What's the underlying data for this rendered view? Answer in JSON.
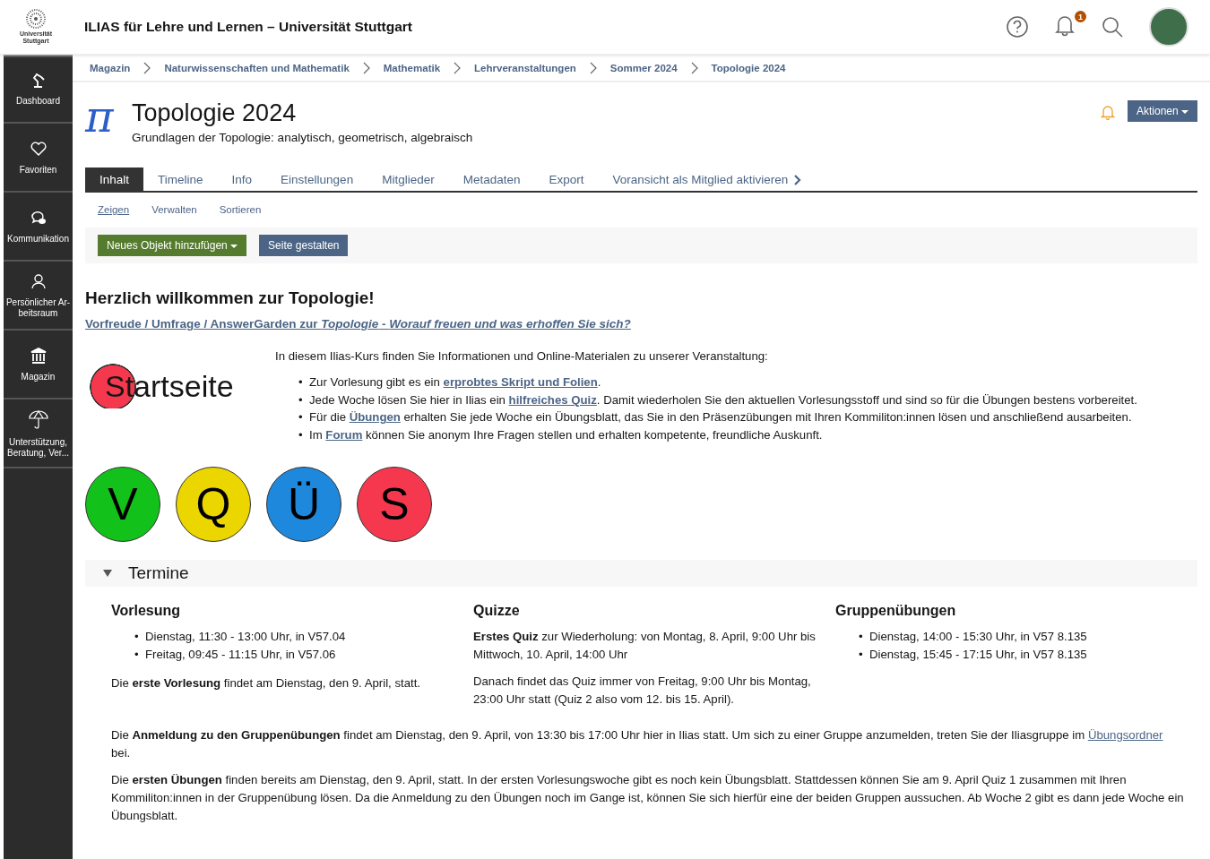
{
  "header": {
    "logo_text": "Universität Stuttgart",
    "title": "ILIAS für Lehre und Lernen – Universität Stuttgart",
    "notification_count": "1"
  },
  "sidebar": {
    "items": [
      {
        "kind": "dashboard",
        "label": "Dashboard",
        "selected": false
      },
      {
        "kind": "favorites",
        "label": "Favoriten",
        "selected": false
      },
      {
        "kind": "communication",
        "label": "Kommunikation",
        "selected": false
      },
      {
        "kind": "personal",
        "label": "Persönlicher Ar-beitsraum",
        "selected": false
      },
      {
        "kind": "repository",
        "label": "Magazin",
        "selected": false
      },
      {
        "kind": "support",
        "label": "Unterstützung, Beratung, Ver...",
        "selected": false
      }
    ]
  },
  "breadcrumbs": [
    "Magazin",
    "Naturwissenschaften und Mathematik",
    "Mathematik",
    "Lehrveranstaltungen",
    "Sommer 2024",
    "Topologie 2024"
  ],
  "course": {
    "icon_text": "π",
    "title": "Topologie 2024",
    "subtitle": "Grundlagen der Topologie: analytisch, geometrisch, algebraisch",
    "actions": "Aktionen"
  },
  "tabs": [
    {
      "label": "Inhalt",
      "selected": true
    },
    {
      "label": "Timeline",
      "selected": false
    },
    {
      "label": "Info",
      "selected": false
    },
    {
      "label": "Einstellungen",
      "selected": false
    },
    {
      "label": "Mitglieder",
      "selected": false
    },
    {
      "label": "Metadaten",
      "selected": false
    },
    {
      "label": "Export",
      "selected": false
    },
    {
      "label": "Voransicht als Mitglied aktivieren",
      "selected": false
    }
  ],
  "subtabs": [
    {
      "label": "Zeigen",
      "selected": true
    },
    {
      "label": "Verwalten",
      "selected": false
    },
    {
      "label": "Sortieren",
      "selected": false
    }
  ],
  "toolbar": {
    "add_button": "Neues Objekt hinzufügen",
    "layout_button": "Seite gestalten"
  },
  "welcome": {
    "heading": "Herzlich willkommen zur Topologie!",
    "link": "Vorfreude / Umfrage / AnswerGarden zur *Topologie* - *Worauf freuen und was erhoffen Sie sich?*"
  },
  "start_badge": "Startseite",
  "intro": "In diesem Ilias-Kurs finden Sie Informationen und Online-Materialen zu unserer Veranstaltung:",
  "intro_items": [
    {
      "bullet": "•",
      "before": "Zur Vorlesung gibt es ein ",
      "link": "erprobtes Skript und Folien",
      "after": "."
    },
    {
      "bullet": "•",
      "before": "Jede Woche lösen Sie hier in Ilias ein ",
      "link": "hilfreiches Quiz",
      "after": ". Damit wiederholen Sie den aktuellen Vorlesungsstoff und sind so für die Übungen bestens vorbereitet."
    },
    {
      "bullet": "•",
      "before": "Für die ",
      "link": "Übungen",
      "after": " erhalten Sie jede Woche ein Übungsblatt, das Sie in den Präsenzübungen mit Ihren Kommiliton:innen lösen und anschließend ausarbeiten."
    },
    {
      "bullet": "•",
      "before": "Im ",
      "link": "Forum",
      "after": " können Sie anonym Ihre Fragen stellen und erhalten kompetente, freundliche Auskunft."
    }
  ],
  "circles": [
    {
      "letter": "V",
      "color": "#12c21a"
    },
    {
      "letter": "Q",
      "color": "#ecd600"
    },
    {
      "letter": "Ü",
      "color": "#1e88dc"
    },
    {
      "letter": "S",
      "color": "#f5384e"
    }
  ],
  "termine": {
    "title": "Termine",
    "expanded": true,
    "columns": [
      {
        "heading": "Vorlesung",
        "items": [
          {
            "bullet": "•",
            "text": "Dienstag, 11:30 - 13:00 Uhr, in V57.04"
          },
          {
            "bullet": "•",
            "text": "Freitag, 09:45 - 11:15 Uhr, in V57.06"
          }
        ],
        "paragraphs": [
          "Die **erste Vorlesung** findet am Dienstag, den 9. April, statt."
        ]
      },
      {
        "heading": "Quizze",
        "paragraphs": [
          "**Erstes Quiz** zur Wiederholung: von Montag, 8. April, 9:00 Uhr bis Mittwoch, 10. April, 14:00 Uhr",
          "Danach findet das Quiz immer von Freitag, 9:00 Uhr bis Montag, 23:00 Uhr statt (Quiz 2 also vom 12. bis 15. April)."
        ]
      },
      {
        "heading": "Gruppenübungen",
        "items": [
          {
            "bullet": "•",
            "text": "Dienstag, 14:00 - 15:30 Uhr, in V57 8.135"
          },
          {
            "bullet": "•",
            "text": "Dienstag, 15:45 - 17:15 Uhr, in V57 8.135"
          }
        ]
      }
    ],
    "notes": [
      {
        "before": "Die **Anmeldung zu den Gruppenübungen** findet am Dienstag, den 9. April, von 13:30 bis 17:00 Uhr hier in Ilias statt. Um sich zu einer Gruppe anzumelden, treten Sie der Iliasgruppe im ",
        "link": "Übungsordner",
        "after": " bei."
      },
      {
        "before": "Die **ersten Übungen** finden bereits am Dienstag, den 9. April, statt. In der ersten Vorlesungswoche gibt es noch kein Übungsblatt. Stattdessen können Sie am 9. April Quiz 1 zusammen mit Ihren Kommiliton:innen in der Gruppenübung lösen. Da die Anmeldung zu den Übungen noch im Gange ist, können Sie sich hierfür eine der beiden Gruppen aussuchen. Ab Woche 2 gibt es dann jede Woche ein Übungsblatt."
      }
    ]
  }
}
